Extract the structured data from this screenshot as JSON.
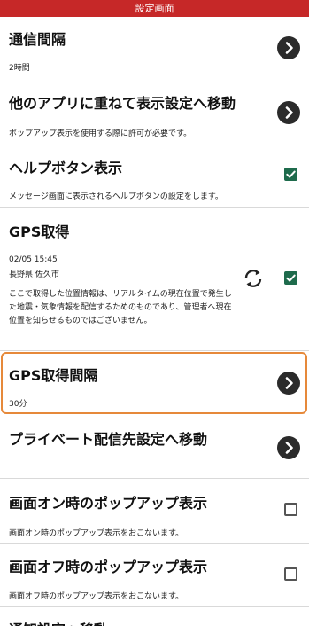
{
  "header": {
    "title": "設定画面"
  },
  "settings": [
    {
      "title": "通信間隔",
      "subtitle": "2時間",
      "control": "chevron"
    },
    {
      "title": "他のアプリに重ねて表示設定へ移動",
      "subtitle": "ポップアップ表示を使用する際に許可が必要です。",
      "control": "chevron"
    },
    {
      "title": "ヘルプボタン表示",
      "subtitle": "メッセージ画面に表示されるヘルプボタンの設定をします。",
      "control": "checkbox",
      "checked": true
    },
    {
      "title": "GPS取得",
      "timestamp": "02/05 15:45",
      "location": "長野県 佐久市",
      "description": "ここで取得した位置情報は、リアルタイムの現在位置で発生した地震・気象情報を配信するためのものであり、管理者へ現在位置を知らせるものではございません。",
      "control": "checkbox",
      "checked": true
    },
    {
      "title": "GPS取得間隔",
      "subtitle": "30分",
      "control": "chevron",
      "focused": true
    },
    {
      "title": "プライベート配信先設定へ移動",
      "subtitle": "",
      "control": "chevron"
    },
    {
      "title": "画面オン時のポップアップ表示",
      "subtitle": "画面オン時のポップアップ表示をおこないます。",
      "control": "checkbox",
      "checked": false
    },
    {
      "title": "画面オフ時のポップアップ表示",
      "subtitle": "画面オフ時のポップアップ表示をおこないます。",
      "control": "checkbox",
      "checked": false
    },
    {
      "title": "通知設定へ移動"
    }
  ],
  "colors": {
    "header_bg": "#c62828",
    "check_on": "#1e6b4c",
    "focus_border": "#e6893a",
    "chevron_bg": "#2b2b2b"
  },
  "icons": {
    "chevron": "chevron-right-icon",
    "check": "check-icon",
    "refresh": "refresh-icon"
  }
}
